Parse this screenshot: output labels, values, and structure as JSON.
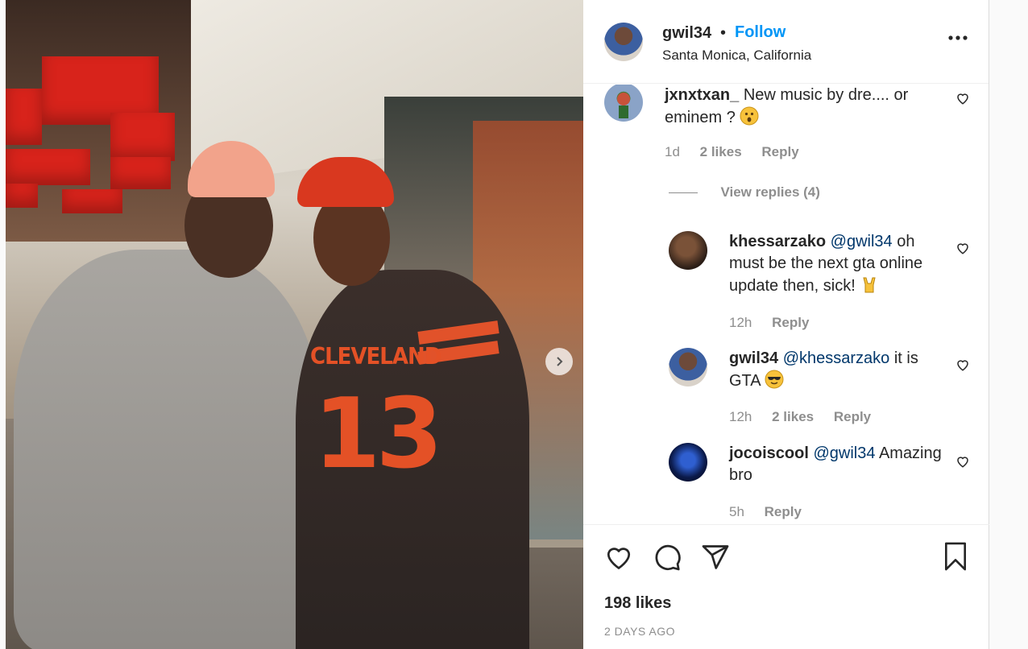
{
  "post": {
    "photo_alt": "",
    "carousel_next_icon": "chevron-right-icon"
  },
  "header": {
    "username": "gwil34",
    "separator": "•",
    "follow_label": "Follow",
    "location": "Santa Monica, California",
    "more_icon": "more-horizontal-icon",
    "more_label": "•••"
  },
  "comments": [
    {
      "username": "jxnxtxan_",
      "text": "New music by dre.... or eminem ?",
      "emoji": "astonished-face-emoji",
      "time": "1d",
      "likes": "2 likes",
      "reply_label": "Reply"
    }
  ],
  "view_replies": "View replies (4)",
  "replies": [
    {
      "username": "khessarzako",
      "mention": "@gwil34",
      "text": "oh must be the next gta online update then, sick!",
      "emoji": "sign-of-the-horns-emoji",
      "time": "12h",
      "reply_label": "Reply"
    },
    {
      "username": "gwil34",
      "mention": "@khessarzako",
      "text": "it is GTA",
      "emoji": "smiling-face-with-sunglasses-emoji",
      "time": "12h",
      "likes": "2 likes",
      "reply_label": "Reply"
    },
    {
      "username": "jocoiscool",
      "mention": "@gwil34",
      "text": "Amazing bro",
      "time": "5h",
      "reply_label": "Reply"
    }
  ],
  "actions": {
    "like_icon": "heart-icon",
    "comment_icon": "comment-icon",
    "share_icon": "send-icon",
    "save_icon": "bookmark-icon",
    "likes_count": "198 likes",
    "date": "2 DAYS AGO"
  },
  "colors": {
    "accent": "#0095f6",
    "mention": "#00376b",
    "muted": "#8e8e8e",
    "text": "#262626"
  }
}
